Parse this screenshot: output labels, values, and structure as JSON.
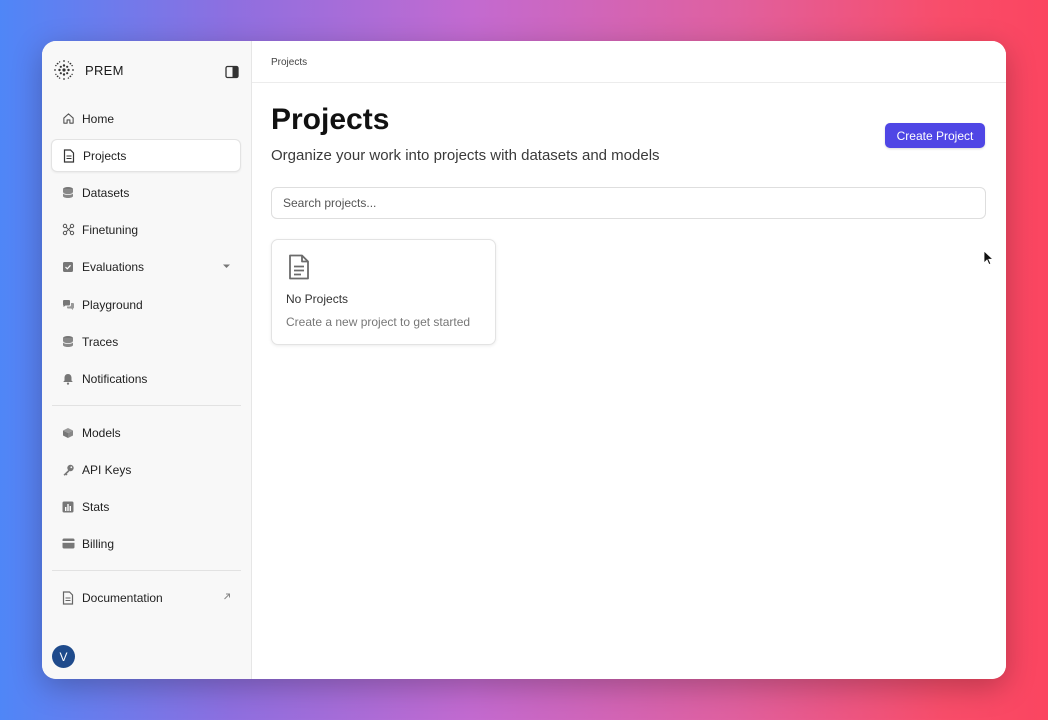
{
  "app": {
    "brand": "PREM"
  },
  "sidebar": {
    "items": [
      {
        "label": "Home",
        "icon": "home-icon"
      },
      {
        "label": "Projects",
        "icon": "document-icon",
        "active": true
      },
      {
        "label": "Datasets",
        "icon": "database-icon"
      },
      {
        "label": "Finetuning",
        "icon": "nodes-icon"
      },
      {
        "label": "Evaluations",
        "icon": "clipboard-icon",
        "has_dropdown": true
      },
      {
        "label": "Playground",
        "icon": "chat-icon"
      },
      {
        "label": "Traces",
        "icon": "stack-icon"
      },
      {
        "label": "Notifications",
        "icon": "bell-icon"
      }
    ],
    "secondary_items": [
      {
        "label": "Models",
        "icon": "cube-icon"
      },
      {
        "label": "API Keys",
        "icon": "key-icon"
      },
      {
        "label": "Stats",
        "icon": "bar-chart-icon"
      },
      {
        "label": "Billing",
        "icon": "credit-card-icon"
      }
    ],
    "documentation": {
      "label": "Documentation",
      "icon": "document-icon",
      "external": true
    },
    "avatar_initial": "V"
  },
  "header": {
    "breadcrumb": "Projects"
  },
  "main": {
    "title": "Projects",
    "subtitle": "Organize your work into projects with datasets and models",
    "create_button": "Create Project",
    "search_placeholder": "Search projects...",
    "empty_state": {
      "title": "No Projects",
      "message": "Create a new project to get started"
    }
  },
  "colors": {
    "accent": "#4f46e5",
    "avatar": "#1f4b8c"
  }
}
